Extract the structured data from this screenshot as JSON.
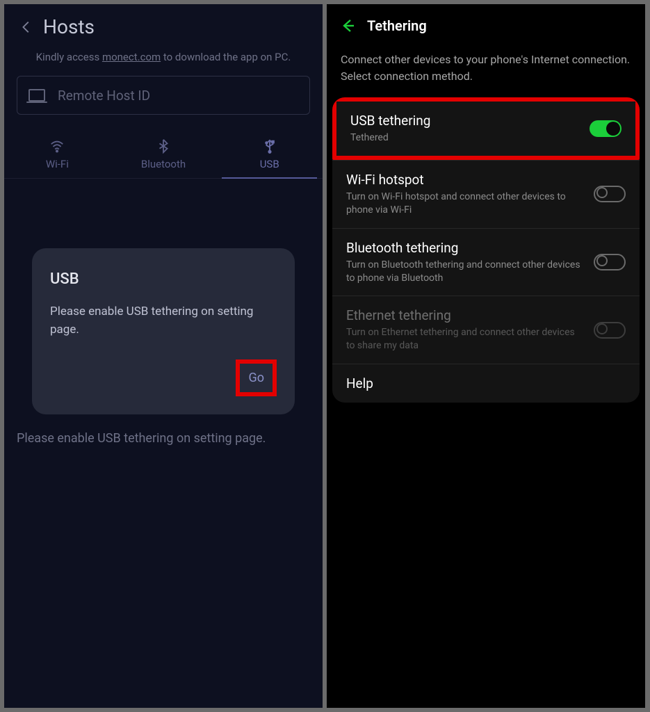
{
  "left": {
    "title": "Hosts",
    "subtext_pre": "Kindly access ",
    "subtext_link": "monect.com",
    "subtext_post": " to download the app on PC.",
    "input_placeholder": "Remote Host ID",
    "tabs": {
      "wifi": "Wi-Fi",
      "bt": "Bluetooth",
      "usb": "USB"
    },
    "card": {
      "title": "USB",
      "body": "Please enable USB tethering on setting page.",
      "go_label": "Go"
    },
    "bottom_text": "Please enable USB tethering on setting page."
  },
  "right": {
    "title": "Tethering",
    "subtitle": "Connect other devices to your phone's Internet connection. Select connection method.",
    "items": {
      "usb": {
        "title": "USB tethering",
        "sub": "Tethered"
      },
      "wifi": {
        "title": "Wi-Fi hotspot",
        "sub": "Turn on Wi-Fi hotspot and connect other devices to phone via Wi-Fi"
      },
      "bt": {
        "title": "Bluetooth tethering",
        "sub": "Turn on Bluetooth tethering and connect other devices to phone via Bluetooth"
      },
      "eth": {
        "title": "Ethernet tethering",
        "sub": "Turn on Ethernet tethering and connect other devices to share my data"
      },
      "help": {
        "title": "Help"
      }
    }
  }
}
